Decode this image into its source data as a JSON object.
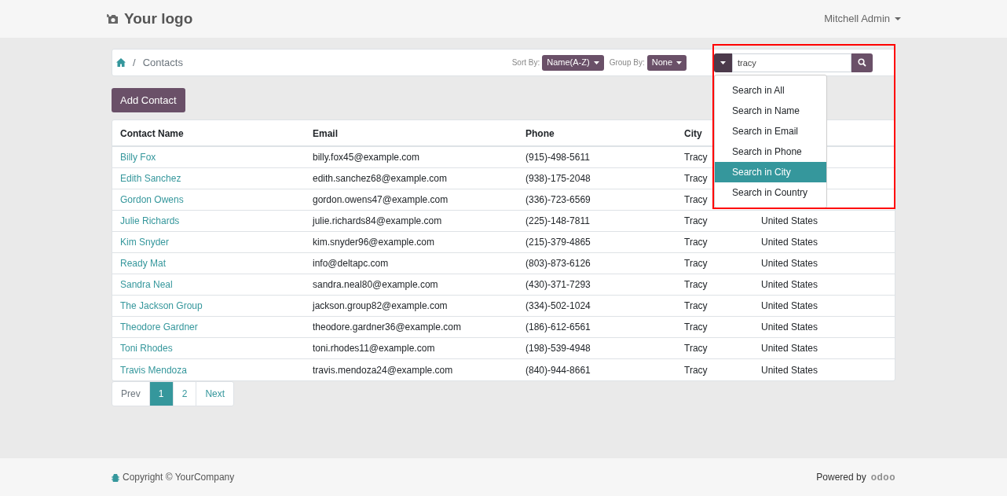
{
  "header": {
    "logo": "Your logo",
    "user_menu": "Mitchell Admin"
  },
  "breadcrumb": {
    "separator": "/",
    "current": "Contacts"
  },
  "sort": {
    "label": "Sort By:",
    "value": "Name(A-Z)"
  },
  "group": {
    "label": "Group By:",
    "value": "None"
  },
  "search": {
    "value": "tracy",
    "options": [
      {
        "label": "Search in All",
        "selected": false
      },
      {
        "label": "Search in Name",
        "selected": false
      },
      {
        "label": "Search in Email",
        "selected": false
      },
      {
        "label": "Search in Phone",
        "selected": false
      },
      {
        "label": "Search in City",
        "selected": true
      },
      {
        "label": "Search in Country",
        "selected": false
      }
    ]
  },
  "add_button": "Add Contact",
  "table": {
    "columns": [
      "Contact Name",
      "Email",
      "Phone",
      "City"
    ],
    "rows": [
      {
        "name": "Billy Fox",
        "email": "billy.fox45@example.com",
        "phone": "(915)-498-5611",
        "city": "Tracy"
      },
      {
        "name": "Edith Sanchez",
        "email": "edith.sanchez68@example.com",
        "phone": "(938)-175-2048",
        "city": "Tracy"
      },
      {
        "name": "Gordon Owens",
        "email": "gordon.owens47@example.com",
        "phone": "(336)-723-6569",
        "city": "Tracy"
      },
      {
        "name": "Julie Richards",
        "email": "julie.richards84@example.com",
        "phone": "(225)-148-7811",
        "city": "Tracy",
        "country": "United States"
      },
      {
        "name": "Kim Snyder",
        "email": "kim.snyder96@example.com",
        "phone": "(215)-379-4865",
        "city": "Tracy",
        "country": "United States"
      },
      {
        "name": "Ready Mat",
        "email": "info@deltapc.com",
        "phone": "(803)-873-6126",
        "city": "Tracy",
        "country": "United States"
      },
      {
        "name": "Sandra Neal",
        "email": "sandra.neal80@example.com",
        "phone": "(430)-371-7293",
        "city": "Tracy",
        "country": "United States"
      },
      {
        "name": "The Jackson Group",
        "email": "jackson.group82@example.com",
        "phone": "(334)-502-1024",
        "city": "Tracy",
        "country": "United States"
      },
      {
        "name": "Theodore Gardner",
        "email": "theodore.gardner36@example.com",
        "phone": "(186)-612-6561",
        "city": "Tracy",
        "country": "United States"
      },
      {
        "name": "Toni Rhodes",
        "email": "toni.rhodes11@example.com",
        "phone": "(198)-539-4948",
        "city": "Tracy",
        "country": "United States"
      },
      {
        "name": "Travis Mendoza",
        "email": "travis.mendoza24@example.com",
        "phone": "(840)-944-8661",
        "city": "Tracy",
        "country": "United States"
      }
    ]
  },
  "pagination": [
    {
      "label": "Prev",
      "selected": false
    },
    {
      "label": "1",
      "selected": true
    },
    {
      "label": "2",
      "selected": false
    },
    {
      "label": "Next",
      "selected": false
    }
  ],
  "footer": {
    "copyright": "Copyright © YourCompany",
    "powered_by": "Powered by",
    "brand": "odoo"
  }
}
